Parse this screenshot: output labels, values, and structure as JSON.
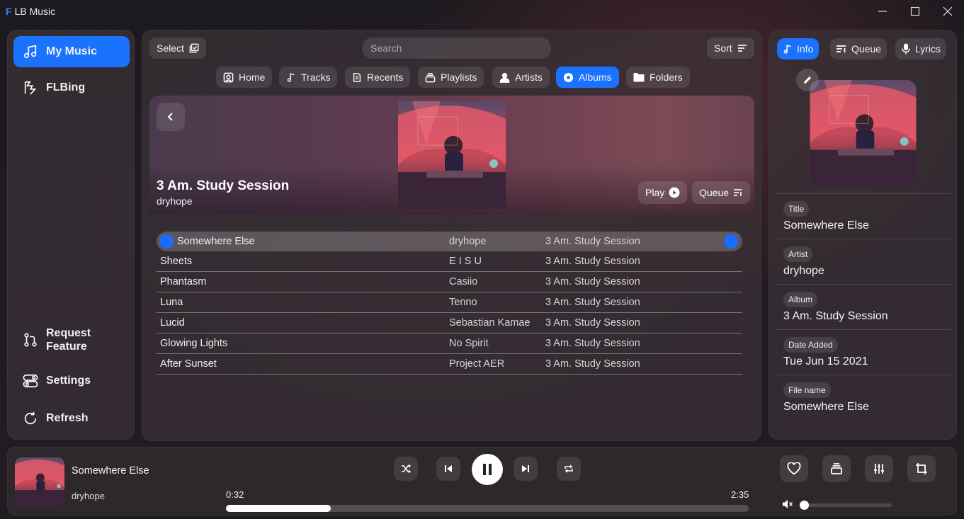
{
  "app": {
    "logo": "F",
    "title": "LB Music"
  },
  "sidebar": {
    "items": [
      {
        "label": "My Music",
        "icon": "music-note-icon",
        "active": true
      },
      {
        "label": "FLBing",
        "icon": "flbing-icon",
        "active": false
      }
    ],
    "bottom": [
      {
        "label": "Request\nFeature",
        "line1": "Request",
        "line2": "Feature",
        "icon": "pull-request-icon"
      },
      {
        "label": "Settings",
        "icon": "toggle-settings-icon"
      },
      {
        "label": "Refresh",
        "icon": "refresh-icon"
      }
    ]
  },
  "toolbar": {
    "select_label": "Select",
    "search_placeholder": "Search",
    "sort_label": "Sort"
  },
  "nav_tabs": [
    {
      "label": "Home",
      "active": false
    },
    {
      "label": "Tracks",
      "active": false
    },
    {
      "label": "Recents",
      "active": false
    },
    {
      "label": "Playlists",
      "active": false
    },
    {
      "label": "Artists",
      "active": false
    },
    {
      "label": "Albums",
      "active": true
    },
    {
      "label": "Folders",
      "active": false
    }
  ],
  "album": {
    "title": "3 Am. Study Session",
    "artist": "dryhope",
    "play_label": "Play",
    "queue_label": "Queue"
  },
  "tracks": [
    {
      "title": "Somewhere Else",
      "artist": "dryhope",
      "album": "3 Am. Study Session",
      "playing": true
    },
    {
      "title": "Sheets",
      "artist": "E I S U",
      "album": "3 Am. Study Session",
      "playing": false
    },
    {
      "title": "Phantasm",
      "artist": "Casiio",
      "album": "3 Am. Study Session",
      "playing": false
    },
    {
      "title": "Luna",
      "artist": "Tenno",
      "album": "3 Am. Study Session",
      "playing": false
    },
    {
      "title": "Lucid",
      "artist": "Sebastian Kamae",
      "album": "3 Am. Study Session",
      "playing": false
    },
    {
      "title": "Glowing Lights",
      "artist": "No Spirit",
      "album": "3 Am. Study Session",
      "playing": false
    },
    {
      "title": "After Sunset",
      "artist": "Project AER",
      "album": "3 Am. Study Session",
      "playing": false
    }
  ],
  "info_panel": {
    "tabs": [
      {
        "label": "Info",
        "active": true
      },
      {
        "label": "Queue",
        "active": false
      },
      {
        "label": "Lyrics",
        "active": false
      }
    ],
    "fields": [
      {
        "label": "Title",
        "value": "Somewhere Else"
      },
      {
        "label": "Artist",
        "value": "dryhope"
      },
      {
        "label": "Album",
        "value": "3 Am. Study Session"
      },
      {
        "label": "Date Added",
        "value": "Tue Jun 15 2021"
      },
      {
        "label": "File name",
        "value": "Somewhere Else"
      }
    ]
  },
  "player": {
    "title": "Somewhere Else",
    "artist": "dryhope",
    "elapsed": "0:32",
    "duration": "2:35",
    "progress_fraction": 0.2,
    "volume_fraction": 0.0
  },
  "colors": {
    "accent": "#1a73ff"
  }
}
